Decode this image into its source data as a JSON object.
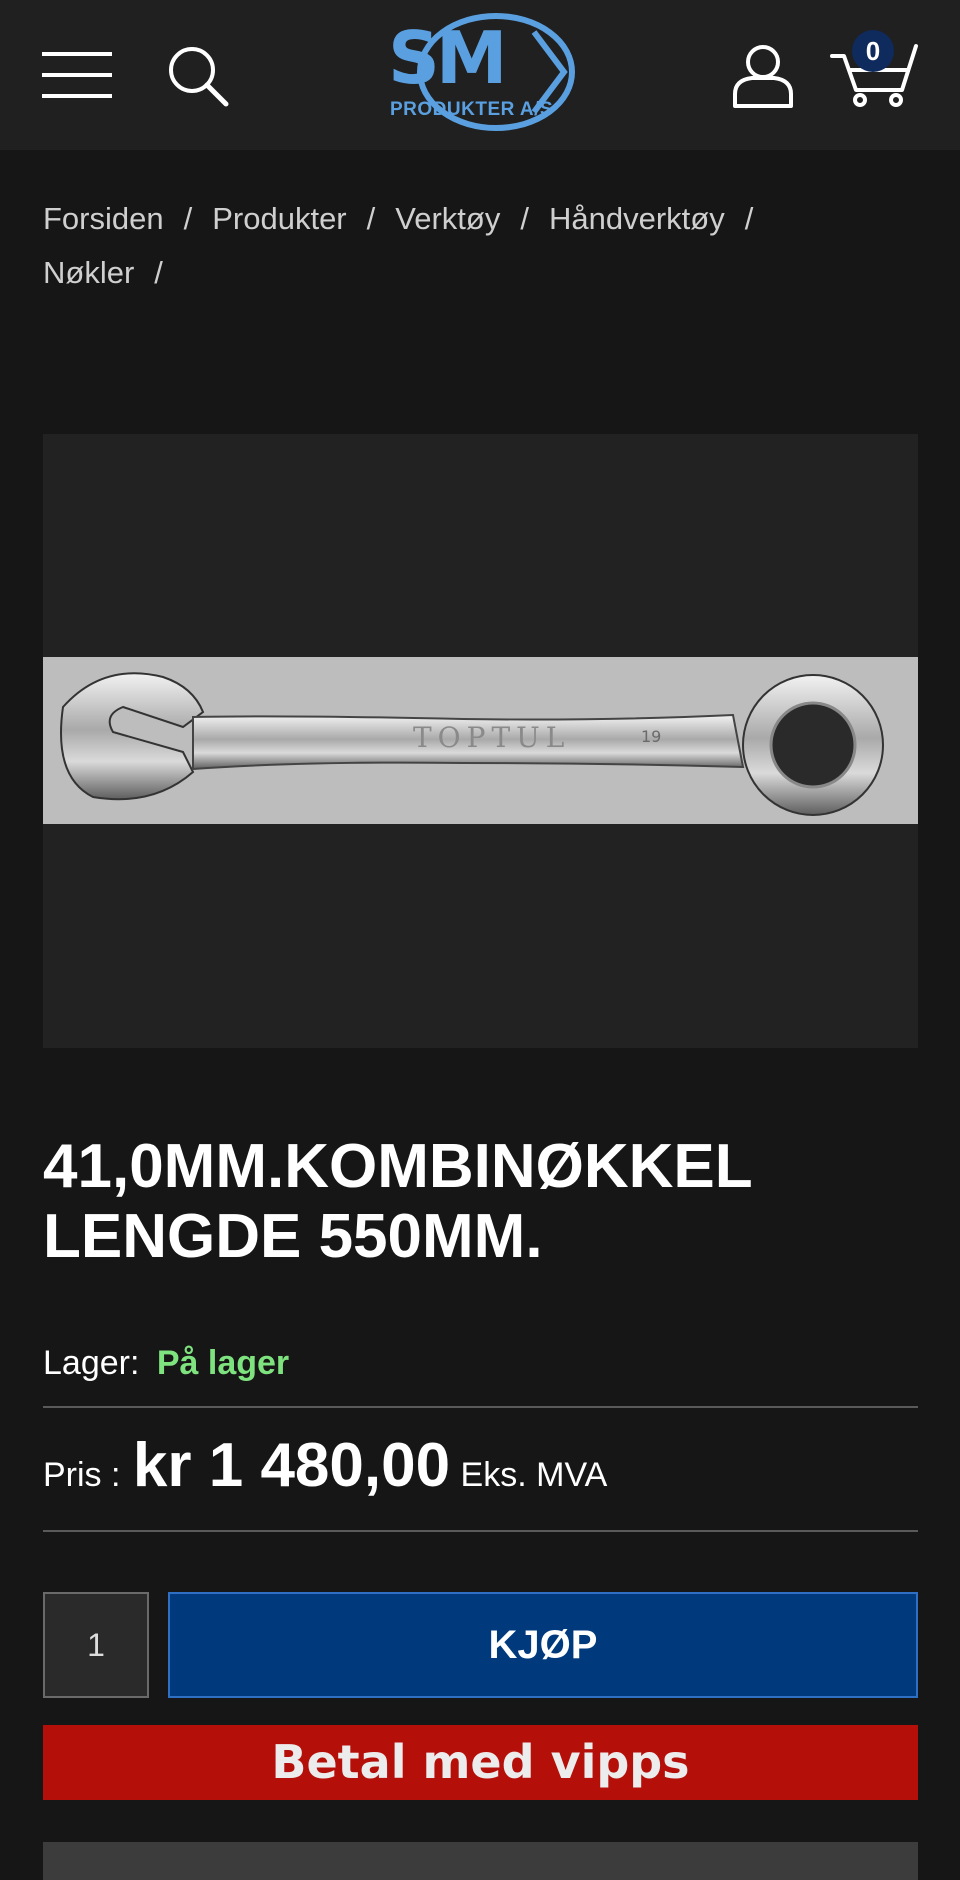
{
  "header": {
    "logo_main": "SM",
    "logo_sub": "PRODUKTER A/S",
    "cart_count": "0",
    "icons": [
      "menu-icon",
      "search-icon",
      "user-icon",
      "cart-icon"
    ]
  },
  "breadcrumb": {
    "items": [
      "Forsiden",
      "Produkter",
      "Verktøy",
      "Håndverktøy",
      "Nøkler"
    ],
    "separator": "/"
  },
  "product": {
    "title_line1": "41,0MM.KOMBINØKKEL",
    "title_line2": "LENGDE 550MM.",
    "stock_label": "Lager:",
    "stock_value": "På lager",
    "price_label": "Pris :",
    "price_value": "kr 1 480,00",
    "price_suffix": "Eks. MVA",
    "image_engraving": "TOPTUL",
    "image_size_mark": "19"
  },
  "purchase": {
    "quantity": "1",
    "buy_label": "KJØP",
    "vipps_label": "Betal med",
    "vipps_brand": "vipps"
  },
  "colors": {
    "background": "#161616",
    "header": "#202020",
    "logo": "#5aa0e0",
    "in_stock": "#7ee27e",
    "buy_button": "#003a7c",
    "vipps_button": "#b50f0a"
  }
}
